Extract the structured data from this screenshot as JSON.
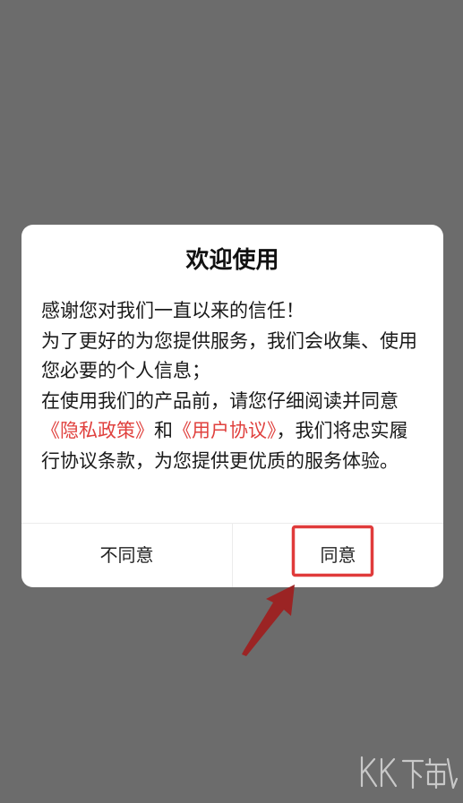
{
  "dialog": {
    "title": "欢迎使用",
    "line1": "感谢您对我们一直以来的信任！",
    "line2": "为了更好的为您提供服务，我们会收集、使用您必要的个人信息；",
    "line3_prefix": "在使用我们的产品前，请您仔细阅读并同意",
    "privacy_link": "《隐私政策》",
    "conjunction": "和",
    "terms_link": "《用户协议》",
    "line3_suffix": "，我们将忠实履行协议条款，为您提供更优质的服务体验。",
    "disagree_label": "不同意",
    "agree_label": "同意"
  },
  "colors": {
    "link": "#e0413e",
    "highlight_box": "#e03b3b",
    "arrow": "#9b2424",
    "overlay": "#6c6c6c"
  },
  "watermark": {
    "text": "KK下载"
  }
}
